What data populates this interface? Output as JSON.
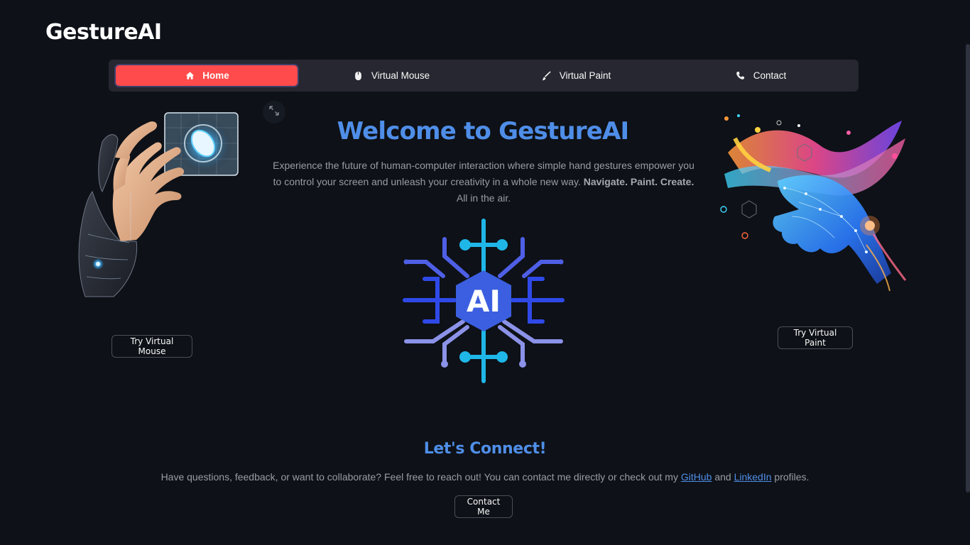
{
  "app": {
    "brand": "GestureAI"
  },
  "nav": {
    "items": [
      {
        "label": "Home",
        "icon": "home-icon",
        "active": true
      },
      {
        "label": "Virtual Mouse",
        "icon": "mouse-icon",
        "active": false
      },
      {
        "label": "Virtual Paint",
        "icon": "brush-icon",
        "active": false
      },
      {
        "label": "Contact",
        "icon": "phone-icon",
        "active": false
      }
    ]
  },
  "hero": {
    "title": "Welcome to GestureAI",
    "text_intro": "Experience the future of human-computer interaction where simple hand gestures empower you to control your screen and unleash your creativity in a whole new way.",
    "text_bold": "Navigate. Paint. Create.",
    "text_outro": "All in the air.",
    "logo_text": "AI"
  },
  "buttons": {
    "try_mouse": "Try Virtual Mouse",
    "try_paint": "Try Virtual Paint",
    "contact_me": "Contact Me"
  },
  "connect": {
    "title": "Let's Connect!",
    "text_before": "Have questions, feedback, or want to collaborate? Feel free to reach out! You can contact me directly or check out my",
    "github": "GitHub",
    "and": "and",
    "linkedin": "LinkedIn",
    "text_after": "profiles."
  },
  "colors": {
    "background": "#0e1117",
    "accent_red": "#ff4b4b",
    "heading_blue": "#4f8ee8",
    "nav_bg": "#262730"
  }
}
